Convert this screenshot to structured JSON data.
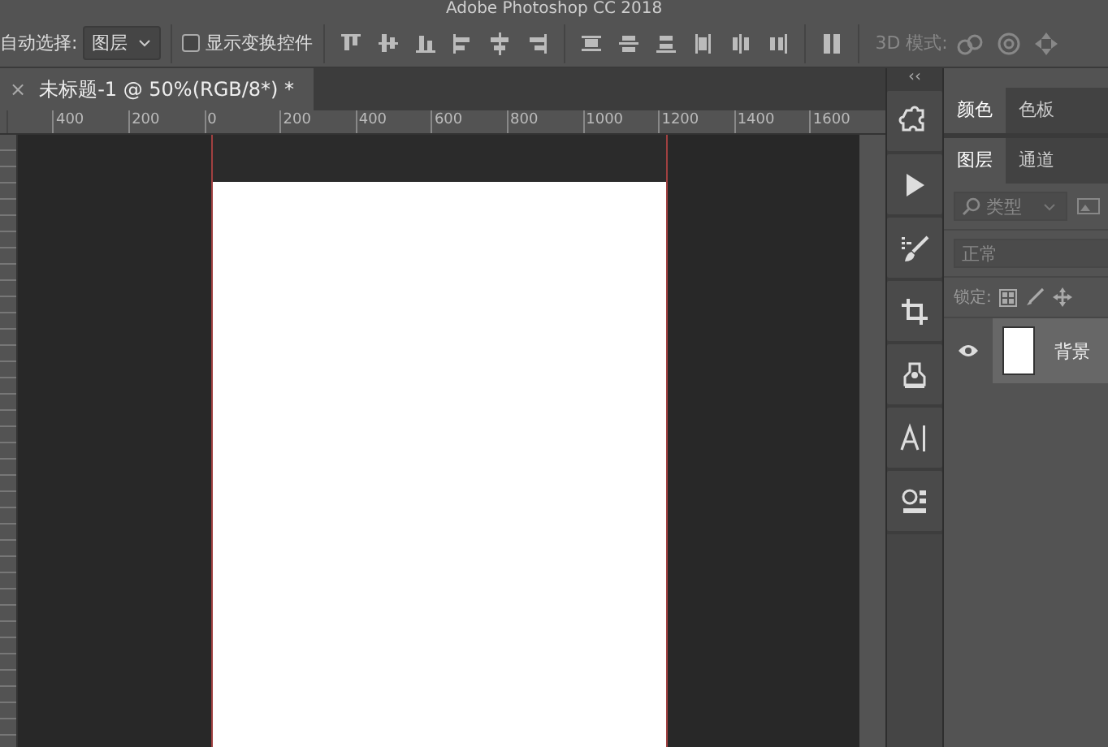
{
  "window": {
    "title": "Adobe Photoshop CC 2018"
  },
  "options_bar": {
    "auto_select_label": "自动选择:",
    "auto_select_value": "图层",
    "show_transform": {
      "label": "显示变换控件",
      "checked": false
    },
    "mode_3d_label": "3D 模式:"
  },
  "document_tab": {
    "close": "×",
    "title": "未标题-1 @ 50%(RGB/8*) *",
    "selected": true
  },
  "ruler": {
    "labels": [
      "400",
      "200",
      "0",
      "200",
      "400",
      "600",
      "800",
      "1000",
      "1200",
      "1400",
      "1600"
    ]
  },
  "panel_collapse": "‹‹",
  "panels": {
    "color_tabs": [
      {
        "label": "颜色",
        "selected": true
      },
      {
        "label": "色板",
        "selected": false
      }
    ],
    "layer_tabs": [
      {
        "label": "图层",
        "selected": true
      },
      {
        "label": "通道",
        "selected": false
      }
    ],
    "filter_placeholder": "类型",
    "blend_mode": "正常",
    "lock_label": "锁定:",
    "layers": [
      {
        "name": "背景",
        "visible": true
      }
    ]
  }
}
